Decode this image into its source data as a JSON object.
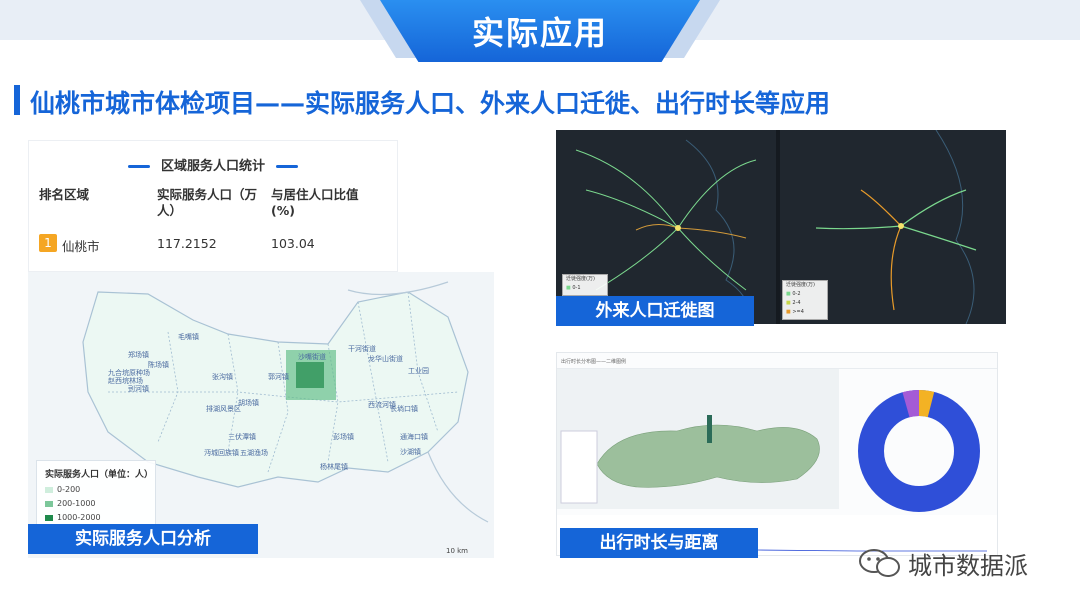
{
  "header": {
    "title": "实际应用"
  },
  "section": {
    "heading": "仙桃市城市体检项目——实际服务人口、外来人口迁徙、出行时长等应用"
  },
  "stats_table": {
    "title": "区域服务人口统计",
    "columns": [
      "排名区域",
      "实际服务人口（万\n人）",
      "与居住人口比值\n(%)"
    ],
    "rows": [
      {
        "rank": "1",
        "region": "仙桃市",
        "population": "117.2152",
        "ratio": "103.04"
      }
    ]
  },
  "service_map": {
    "caption": "实际服务人口分析",
    "legend_title": "实际服务人口（单位：人）",
    "legend_items": [
      "0-200",
      "200-1000",
      "1000-2000"
    ],
    "legend_colors": [
      "#cfeedd",
      "#7cc79a",
      "#1f8a4c"
    ],
    "scale": "10 km",
    "place_labels": [
      "剅河镇",
      "郑场镇",
      "张沟镇",
      "毛嘴镇",
      "彭场镇",
      "胡场镇",
      "杨林尾镇",
      "沙湖镇",
      "长埫口镇",
      "西流河镇",
      "陈场镇",
      "通海口镇",
      "郭河镇",
      "三伏潭镇",
      "干河街道",
      "沔城回族镇",
      "排湖风景区",
      "五湖渔场",
      "沙嘴街道",
      "龙华山街道",
      "九合垸原种场",
      "赵西垸林场",
      "工业园"
    ]
  },
  "migration": {
    "caption": "外来人口迁徙图",
    "legend_title": "迁徙强度(万)",
    "legend_a": [
      "0-1"
    ],
    "legend_b": [
      "0-2",
      "2-4",
      ">=4"
    ]
  },
  "travel": {
    "caption": "出行时长与距离",
    "header_text": "出行时长分布图——二维图例"
  },
  "watermark": {
    "text": "城市数据派"
  }
}
